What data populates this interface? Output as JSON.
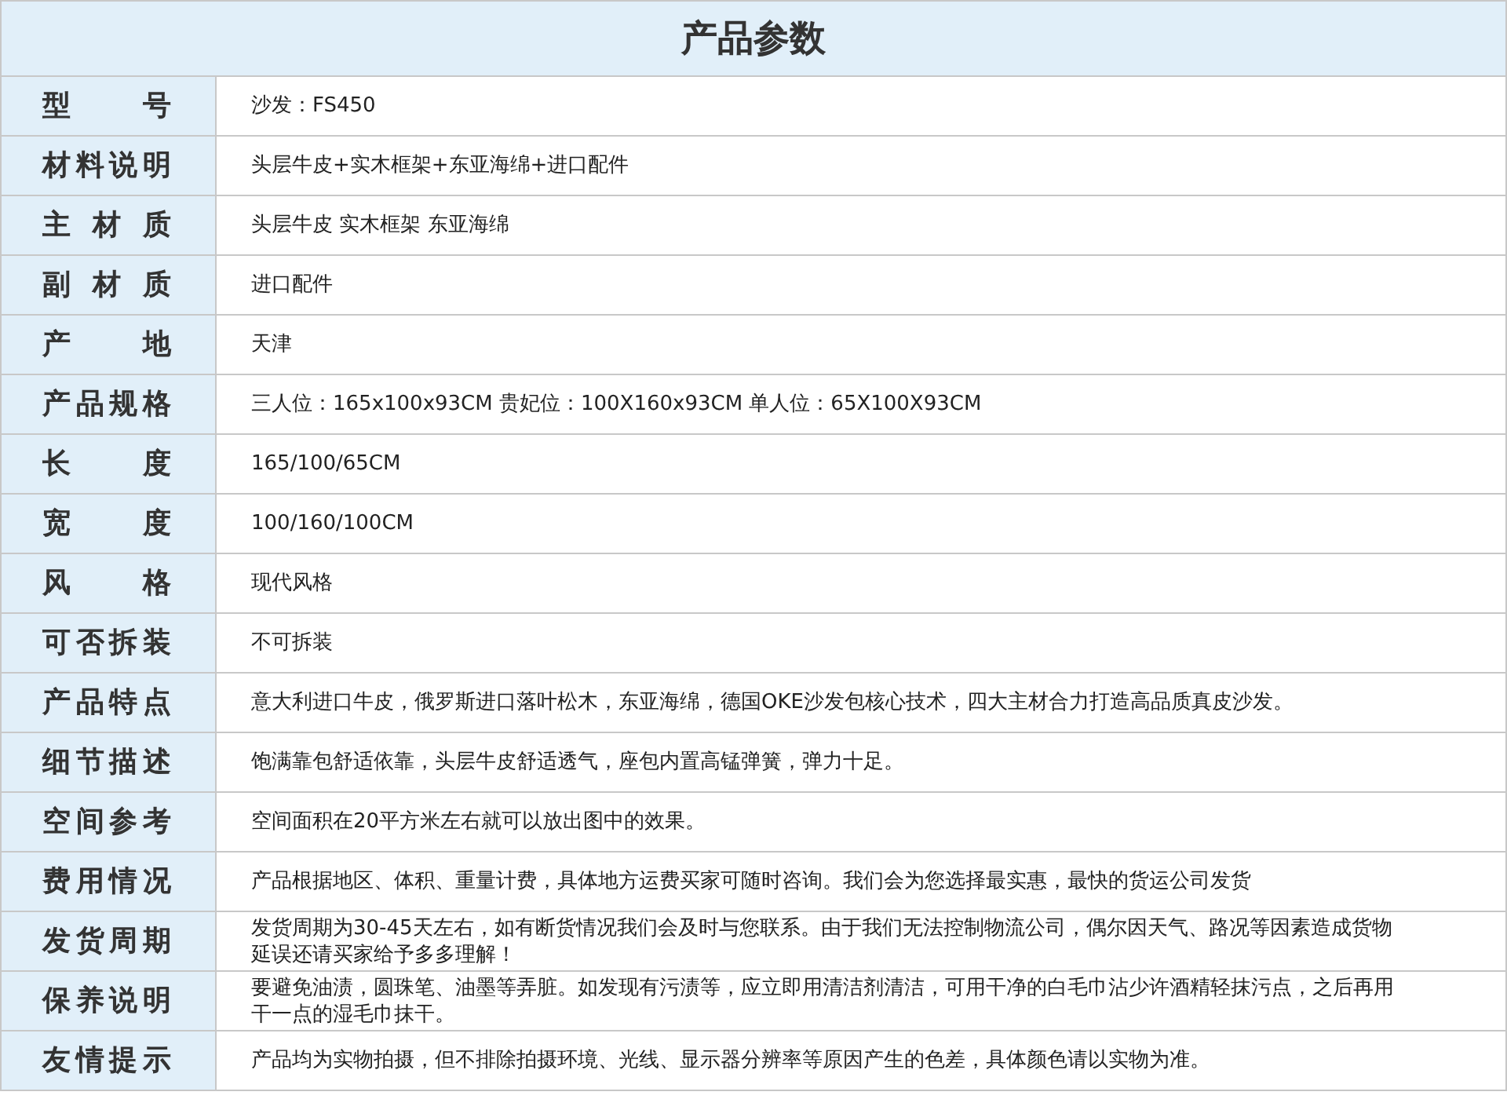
{
  "title": "产品参数",
  "rows": [
    {
      "label": "型 号",
      "value": "沙发：FS450"
    },
    {
      "label": "材料说明",
      "value": "头层牛皮+实木框架+东亚海绵+进口配件"
    },
    {
      "label": "主 材 质",
      "value": "头层牛皮 实木框架 东亚海绵"
    },
    {
      "label": "副 材 质",
      "value": "进口配件"
    },
    {
      "label": "产 地",
      "value": "天津"
    },
    {
      "label": "产品规格",
      "value": "三人位：165x100x93CM 贵妃位：100X160x93CM 单人位：65X100X93CM"
    },
    {
      "label": "长 度",
      "value": "165/100/65CM"
    },
    {
      "label": "宽 度",
      "value": "100/160/100CM"
    },
    {
      "label": "风 格",
      "value": "现代风格"
    },
    {
      "label": "可否拆装",
      "value": "不可拆装"
    },
    {
      "label": "产品特点",
      "value": "意大利进口牛皮，俄罗斯进口落叶松木，东亚海绵，德国OKE沙发包核心技术，四大主材合力打造高品质真皮沙发。"
    },
    {
      "label": "细节描述",
      "value": "饱满靠包舒适依靠，头层牛皮舒适透气，座包内置高锰弹簧，弹力十足。"
    },
    {
      "label": "空间参考",
      "value": "空间面积在20平方米左右就可以放出图中的效果。"
    },
    {
      "label": "费用情况",
      "value": "产品根据地区、体积、重量计费，具体地方运费买家可随时咨询。我们会为您选择最实惠，最快的货运公司发货"
    },
    {
      "label": "发货周期",
      "value": "发货周期为30-45天左右，如有断货情况我们会及时与您联系。由于我们无法控制物流公司，偶尔因天气、路况等因素造成货物延误还请买家给予多多理解！"
    },
    {
      "label": "保养说明",
      "value": "要避免油渍，圆珠笔、油墨等弄脏。如发现有污渍等，应立即用清洁剂清洁，可用干净的白毛巾沾少许酒精轻抹污点，之后再用干一点的湿毛巾抹干。"
    },
    {
      "label": "友情提示",
      "value": "产品均为实物拍摄，但不排除拍摄环境、光线、显示器分辨率等原因产生的色差，具体颜色请以实物为准。"
    }
  ]
}
